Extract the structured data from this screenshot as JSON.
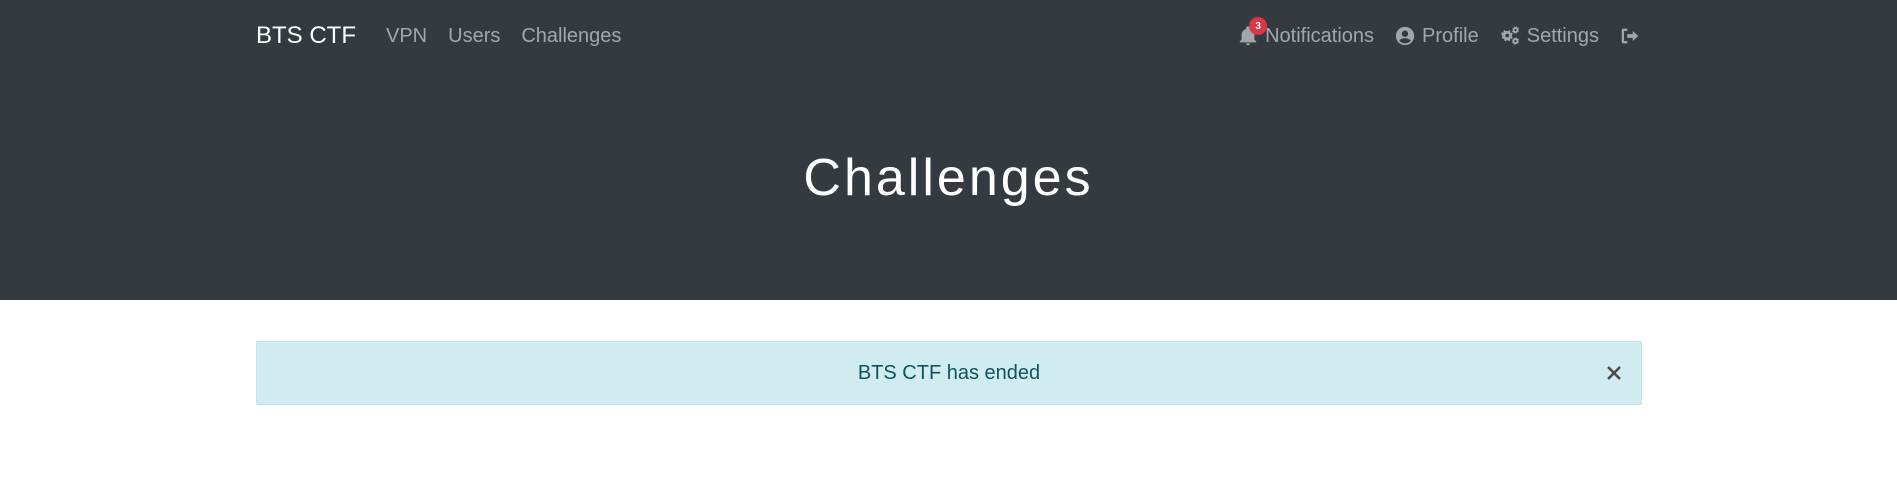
{
  "navbar": {
    "brand": "BTS CTF",
    "links": [
      {
        "label": "VPN"
      },
      {
        "label": "Users"
      },
      {
        "label": "Challenges"
      }
    ],
    "notifications": {
      "label": "Notifications",
      "badge": "3",
      "icon": "bell-icon"
    },
    "profile": {
      "label": "Profile",
      "icon": "user-circle-icon"
    },
    "settings": {
      "label": "Settings",
      "icon": "cogs-icon"
    },
    "logout": {
      "icon": "sign-out-icon"
    }
  },
  "jumbotron": {
    "title": "Challenges"
  },
  "alert": {
    "message": "BTS CTF has ended",
    "close_icon": "close-icon"
  },
  "colors": {
    "header_bg": "#343a40",
    "alert_bg": "#d1ecf1",
    "alert_text": "#0c5460",
    "badge": "#dc3545"
  }
}
